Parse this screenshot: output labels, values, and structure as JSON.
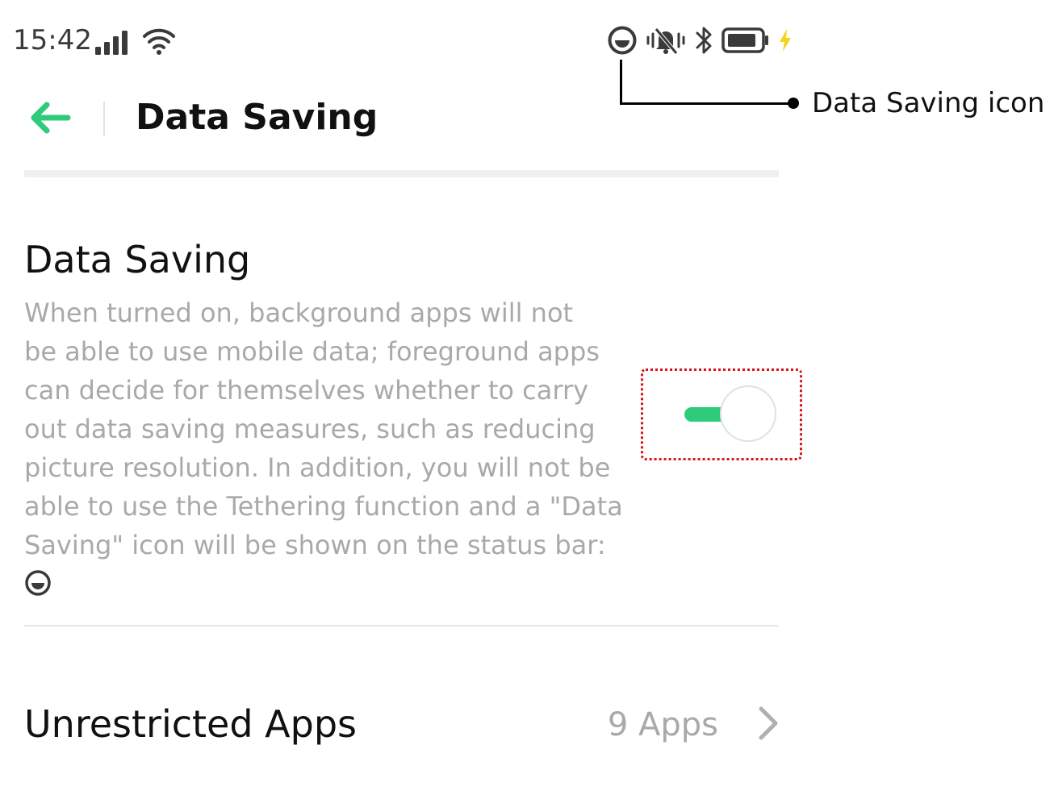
{
  "status_bar": {
    "time": "15:42",
    "left_icons": [
      "signal-bars-icon",
      "wifi-icon"
    ],
    "right_icons": [
      "data-saving-icon",
      "vibrate-silent-icon",
      "bluetooth-icon",
      "battery-icon",
      "charging-bolt-icon"
    ]
  },
  "annotation": {
    "label": "Data Saving icon"
  },
  "header": {
    "title": "Data Saving",
    "back_icon": "back-arrow-icon"
  },
  "data_saving": {
    "title": "Data Saving",
    "description_lines": [
      "When turned on, background apps will not",
      "be able to use mobile data; foreground apps",
      "can decide for themselves whether to carry",
      "out data saving measures, such as reducing",
      "picture resolution. In addition, you will not be",
      "able to use the Tethering function and a \"Data",
      "Saving\" icon will be shown on the status bar:"
    ],
    "inline_icon": "data-saving-icon",
    "toggle_on": false
  },
  "unrestricted_apps": {
    "label": "Unrestricted Apps",
    "count": "9 Apps",
    "chevron_icon": "chevron-right-icon"
  },
  "colors": {
    "accent": "#2ecc7a",
    "highlight_border": "#d7141a",
    "secondary_text": "#a9a9a9",
    "charging": "#f5d31b"
  }
}
